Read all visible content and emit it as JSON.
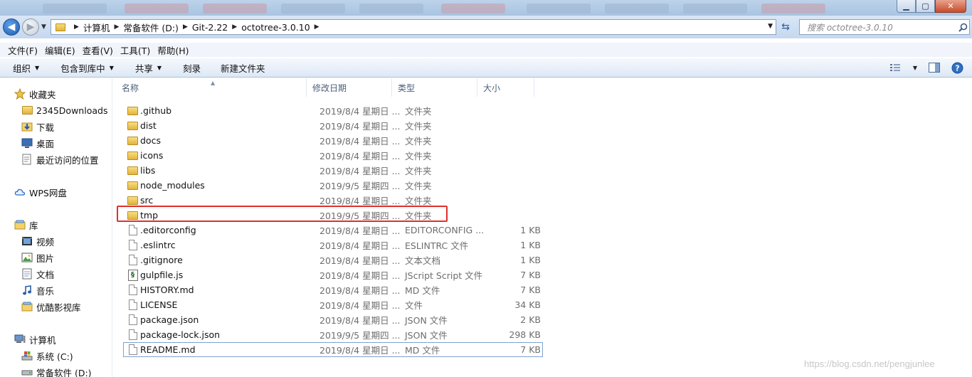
{
  "window": {
    "controls": {
      "minimize": "▁",
      "maximize": "▢",
      "close": "✕"
    }
  },
  "address": {
    "crumbs": [
      "计算机",
      "常备软件 (D:)",
      "Git-2.22",
      "octotree-3.0.10"
    ],
    "search_placeholder": "搜索 octotree-3.0.10"
  },
  "menu": [
    "文件(F)",
    "编辑(E)",
    "查看(V)",
    "工具(T)",
    "帮助(H)"
  ],
  "toolbar": {
    "organize": "组织",
    "include_library": "包含到库中",
    "share": "共享",
    "burn": "刻录",
    "new_folder": "新建文件夹"
  },
  "nav": {
    "favorites": {
      "label": "收藏夹",
      "items": [
        "2345Downloads",
        "下载",
        "桌面",
        "最近访问的位置"
      ]
    },
    "wps": "WPS网盘",
    "libraries": {
      "label": "库",
      "items": [
        "视频",
        "图片",
        "文档",
        "音乐",
        "优酷影视库"
      ]
    },
    "computer": {
      "label": "计算机",
      "items": [
        "系统 (C:)",
        "常备软件 (D:)"
      ]
    }
  },
  "columns": {
    "name": "名称",
    "date": "修改日期",
    "type": "类型",
    "size": "大小"
  },
  "files": [
    {
      "name": ".github",
      "date": "2019/8/4 星期日 ...",
      "type": "文件夹",
      "size": "",
      "icon": "folder-icon"
    },
    {
      "name": "dist",
      "date": "2019/8/4 星期日 ...",
      "type": "文件夹",
      "size": "",
      "icon": "folder-icon"
    },
    {
      "name": "docs",
      "date": "2019/8/4 星期日 ...",
      "type": "文件夹",
      "size": "",
      "icon": "folder-icon"
    },
    {
      "name": "icons",
      "date": "2019/8/4 星期日 ...",
      "type": "文件夹",
      "size": "",
      "icon": "folder-icon"
    },
    {
      "name": "libs",
      "date": "2019/8/4 星期日 ...",
      "type": "文件夹",
      "size": "",
      "icon": "folder-icon"
    },
    {
      "name": "node_modules",
      "date": "2019/9/5 星期四 ...",
      "type": "文件夹",
      "size": "",
      "icon": "folder-icon"
    },
    {
      "name": "src",
      "date": "2019/8/4 星期日 ...",
      "type": "文件夹",
      "size": "",
      "icon": "folder-icon"
    },
    {
      "name": "tmp",
      "date": "2019/9/5 星期四 ...",
      "type": "文件夹",
      "size": "",
      "icon": "folder-icon"
    },
    {
      "name": ".editorconfig",
      "date": "2019/8/4 星期日 ...",
      "type": "EDITORCONFIG ...",
      "size": "1 KB",
      "icon": "file-icon"
    },
    {
      "name": ".eslintrc",
      "date": "2019/8/4 星期日 ...",
      "type": "ESLINTRC 文件",
      "size": "1 KB",
      "icon": "file-icon"
    },
    {
      "name": ".gitignore",
      "date": "2019/8/4 星期日 ...",
      "type": "文本文档",
      "size": "1 KB",
      "icon": "file-icon"
    },
    {
      "name": "gulpfile.js",
      "date": "2019/8/4 星期日 ...",
      "type": "JScript Script 文件",
      "size": "7 KB",
      "icon": "script-icon"
    },
    {
      "name": "HISTORY.md",
      "date": "2019/8/4 星期日 ...",
      "type": "MD 文件",
      "size": "7 KB",
      "icon": "file-icon"
    },
    {
      "name": "LICENSE",
      "date": "2019/8/4 星期日 ...",
      "type": "文件",
      "size": "34 KB",
      "icon": "file-icon"
    },
    {
      "name": "package.json",
      "date": "2019/8/4 星期日 ...",
      "type": "JSON 文件",
      "size": "2 KB",
      "icon": "file-icon"
    },
    {
      "name": "package-lock.json",
      "date": "2019/9/5 星期四 ...",
      "type": "JSON 文件",
      "size": "298 KB",
      "icon": "file-icon"
    },
    {
      "name": "README.md",
      "date": "2019/8/4 星期日 ...",
      "type": "MD 文件",
      "size": "7 KB",
      "icon": "file-icon"
    }
  ],
  "highlighted_file": "tmp",
  "focused_file": "README.md",
  "watermark": "https://blog.csdn.net/pengjunlee",
  "colors": {
    "highlight": "#e0302a",
    "focus_border": "#7da2ce"
  }
}
